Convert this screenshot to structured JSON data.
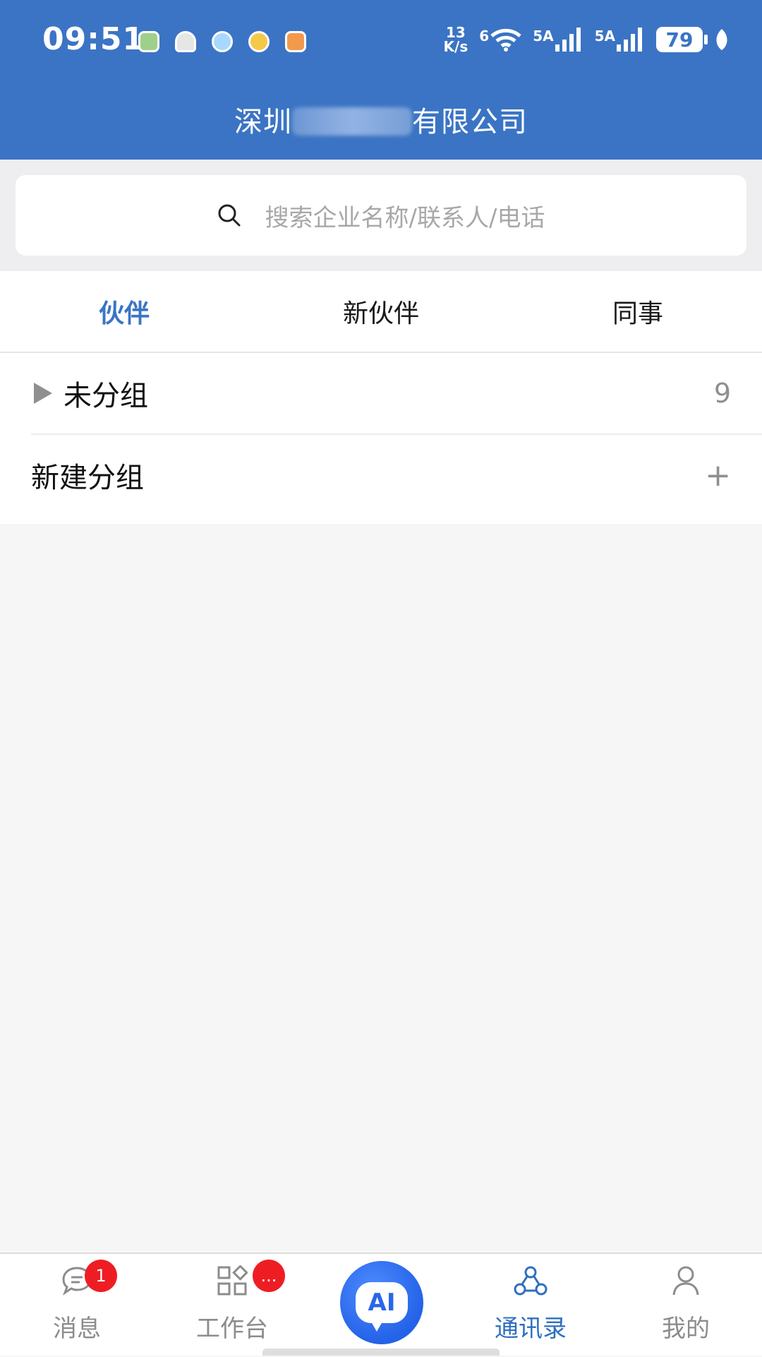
{
  "status_bar": {
    "time": "09:51",
    "net_speed_value": "13",
    "net_speed_unit": "K/s",
    "wifi_label": "6",
    "signal1_label": "5A",
    "signal2_label": "5A",
    "battery": "79"
  },
  "header": {
    "title_prefix": "深圳",
    "title_suffix": "有限公司"
  },
  "search": {
    "placeholder": "搜索企业名称/联系人/电话"
  },
  "tabs": [
    {
      "label": "伙伴",
      "active": true
    },
    {
      "label": "新伙伴",
      "active": false
    },
    {
      "label": "同事",
      "active": false
    }
  ],
  "groups": {
    "ungrouped_label": "未分组",
    "ungrouped_count": "9",
    "new_group_label": "新建分组"
  },
  "bottom_nav": {
    "items": [
      {
        "label": "消息",
        "badge": "1",
        "icon": "chat-bubble-icon"
      },
      {
        "label": "工作台",
        "badge": "...",
        "icon": "apps-grid-icon"
      },
      {
        "label": "AI",
        "icon": "ai-assistant-icon"
      },
      {
        "label": "通讯录",
        "active": true,
        "icon": "contacts-network-icon"
      },
      {
        "label": "我的",
        "icon": "user-profile-icon"
      }
    ]
  },
  "colors": {
    "brand_blue": "#3b74c4",
    "active_tab": "#3b74c4",
    "badge_red": "#ee1d24"
  }
}
